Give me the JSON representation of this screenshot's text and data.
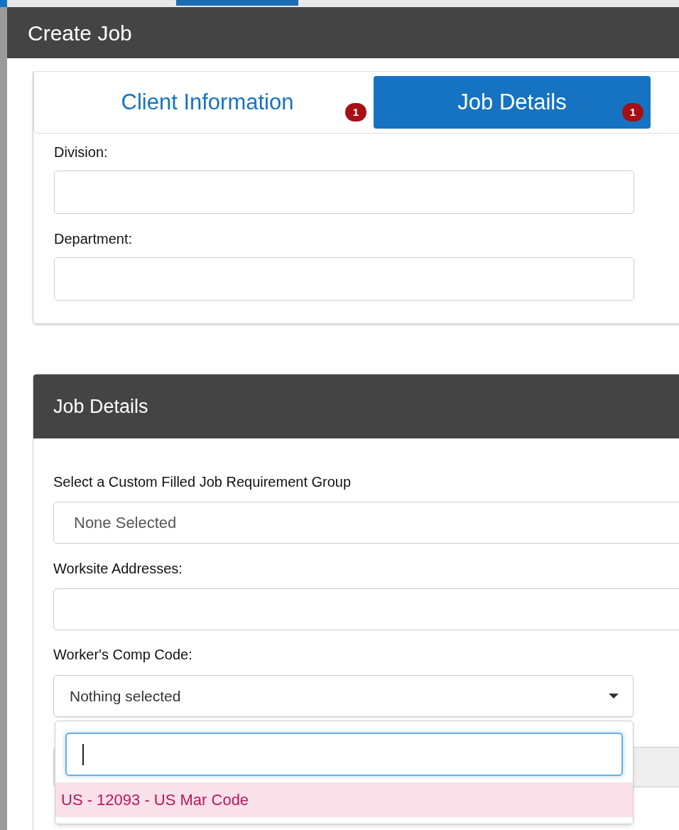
{
  "window": {
    "title": "Create Job"
  },
  "tabs": [
    {
      "label": "Client Information",
      "badge": "1",
      "selected": false
    },
    {
      "label": "Job Details",
      "badge": "1",
      "selected": true
    }
  ],
  "client_fields": [
    {
      "label": "Division:"
    },
    {
      "label": "Department:"
    }
  ],
  "job_details": {
    "title": "Job Details",
    "fields": [
      {
        "kind": "select",
        "label": "Select a Custom Filled Job Requirement Group",
        "value": "None Selected"
      },
      {
        "kind": "text",
        "label": "Worksite Addresses:"
      },
      {
        "kind": "dropdown",
        "label": "Worker's Comp Code:",
        "value": "Nothing selected",
        "expanded": true,
        "options": [
          {
            "label": "US - 12093 - US Mar Code",
            "selected": true
          }
        ]
      }
    ]
  }
}
